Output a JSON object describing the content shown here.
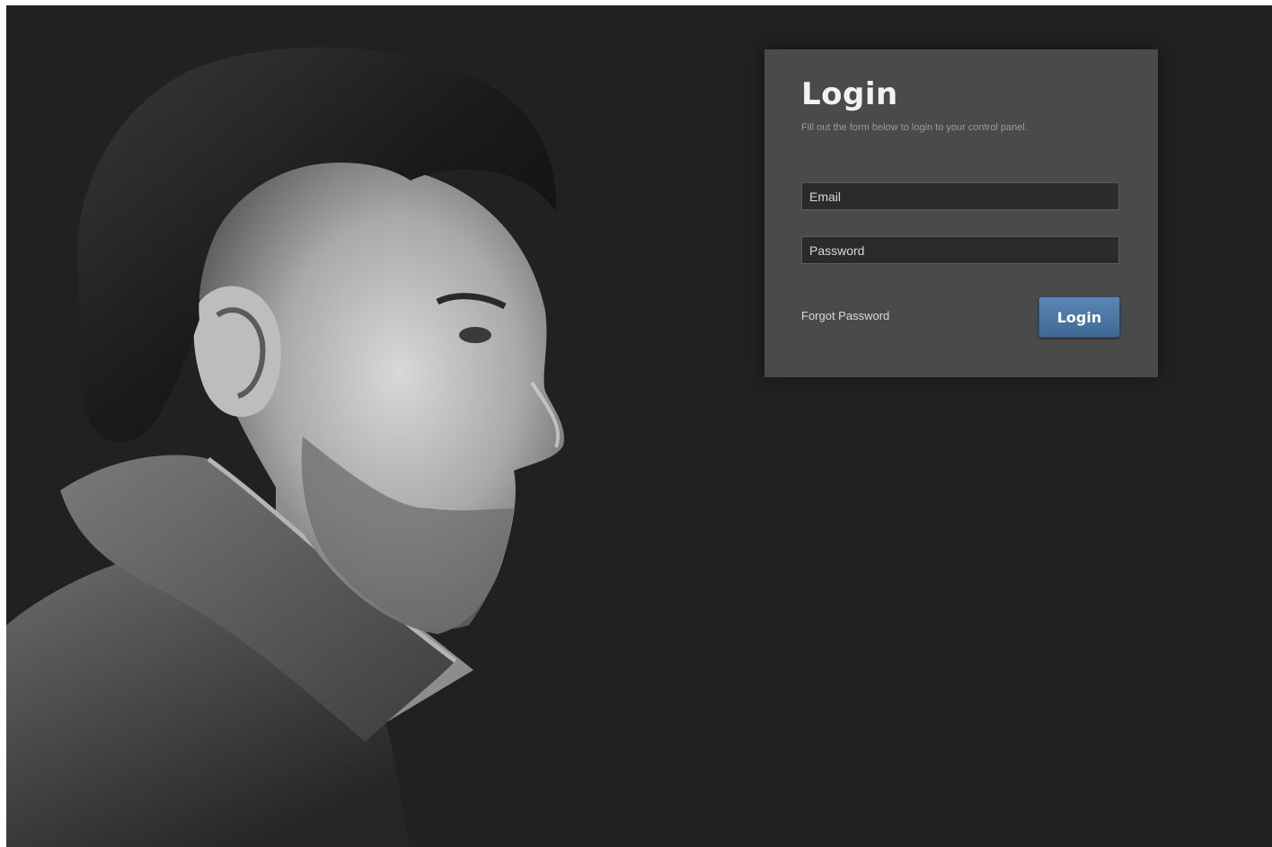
{
  "hero": {
    "image_name": "portrait-photo"
  },
  "login": {
    "title": "Login",
    "subtitle": "Fill out the form below to login to your control panel.",
    "email_placeholder": "Email",
    "password_placeholder": "Password",
    "forgot_label": "Forgot Password",
    "button_label": "Login"
  },
  "colors": {
    "background": "#212121",
    "panel": "#4a4a4a",
    "input": "#2b2b2b",
    "button": "#4a76a3"
  }
}
